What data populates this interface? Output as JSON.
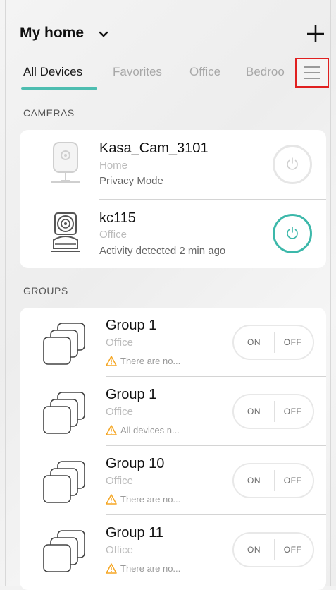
{
  "header": {
    "title": "My home"
  },
  "tabs": [
    {
      "label": "All Devices",
      "active": true
    },
    {
      "label": "Favorites"
    },
    {
      "label": "Office"
    },
    {
      "label": "Bedroo"
    }
  ],
  "sections": {
    "cameras": "CAMERAS",
    "groups": "GROUPS"
  },
  "cameras": [
    {
      "name": "Kasa_Cam_3101",
      "room": "Home",
      "status": "Privacy Mode",
      "power": "off"
    },
    {
      "name": "kc115",
      "room": "Office",
      "status": "Activity detected 2 min ago",
      "power": "on"
    }
  ],
  "groups": [
    {
      "name": "Group 1",
      "room": "Office",
      "warning": "There are no..."
    },
    {
      "name": "Group 1",
      "room": "Office",
      "warning": "All devices n..."
    },
    {
      "name": "Group 10",
      "room": "Office",
      "warning": "There are no..."
    },
    {
      "name": "Group 11",
      "room": "Office",
      "warning": "There are no..."
    }
  ],
  "toggle": {
    "on": "ON",
    "off": "OFF"
  },
  "colors": {
    "accent": "#4dbdb0",
    "highlight": "#e02020",
    "warning": "#f5a623"
  }
}
